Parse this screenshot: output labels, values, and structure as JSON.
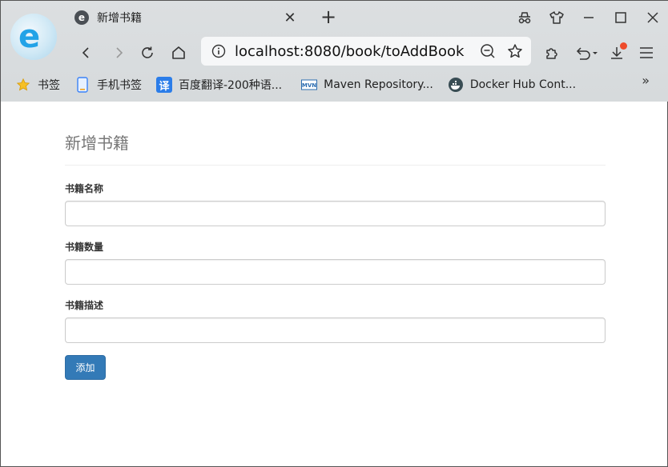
{
  "browser": {
    "tab_title": "新增书籍",
    "url": "localhost:8080/book/toAddBook",
    "bookmarks": [
      {
        "label": "书签",
        "icon": "star-icon"
      },
      {
        "label": "手机书签",
        "icon": "phone-icon"
      },
      {
        "label": "百度翻译-200种语...",
        "icon": "translate-icon"
      },
      {
        "label": "Maven Repository...",
        "icon": "maven-icon"
      },
      {
        "label": "Docker Hub Cont...",
        "icon": "docker-icon"
      }
    ],
    "more_label": "»",
    "colors": {
      "accent": "#1aa0e8",
      "badge": "#ee4b2b"
    }
  },
  "page": {
    "title": "新增书籍",
    "fields": [
      {
        "label": "书籍名称",
        "value": "",
        "placeholder": ""
      },
      {
        "label": "书籍数量",
        "value": "",
        "placeholder": ""
      },
      {
        "label": "书籍描述",
        "value": "",
        "placeholder": ""
      }
    ],
    "submit_label": "添加",
    "colors": {
      "primary": "#337ab7",
      "title": "#777777"
    }
  }
}
